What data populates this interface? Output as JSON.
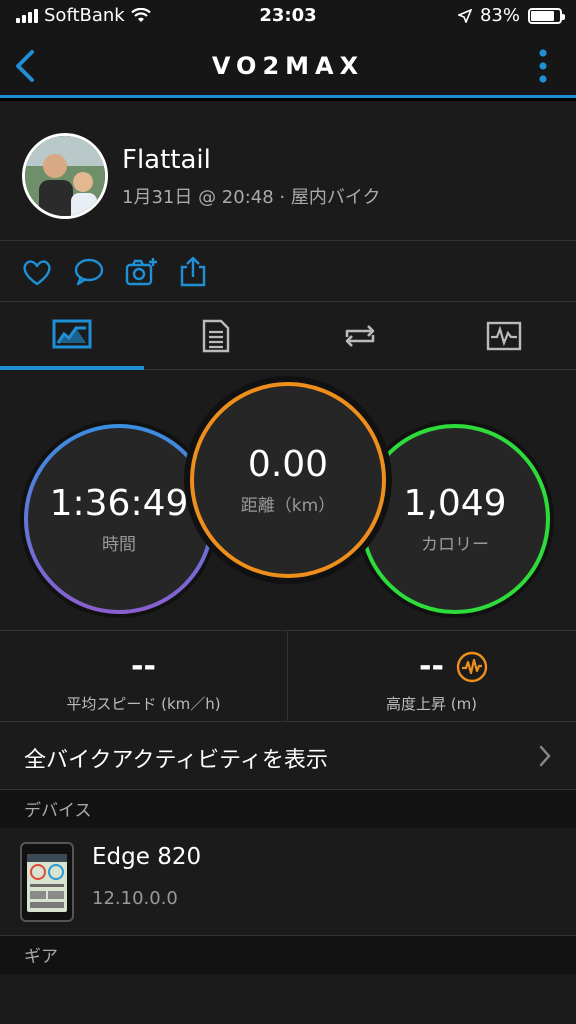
{
  "status_bar": {
    "carrier": "SoftBank",
    "time": "23:03",
    "battery": "83%",
    "battery_level": 0.83
  },
  "nav": {
    "title": "VO2MAX"
  },
  "activity": {
    "user_name": "Flattail",
    "meta": "1月31日 @ 20:48 · 屋内バイク"
  },
  "circles": {
    "time": {
      "value": "1:36:49",
      "label": "時間"
    },
    "distance": {
      "value": "0.00",
      "label": "距離（km）"
    },
    "calories": {
      "value": "1,049",
      "label": "カロリー"
    }
  },
  "stats": {
    "avg_speed": {
      "value": "--",
      "label": "平均スピード (km／h)"
    },
    "elevation": {
      "value": "--",
      "label": "高度上昇 (m)"
    }
  },
  "links": {
    "all_bike_activities": "全バイクアクティビティを表示"
  },
  "sections": {
    "device": "デバイス",
    "gear": "ギア"
  },
  "device": {
    "name": "Edge 820",
    "version": "12.10.0.0"
  },
  "colors": {
    "accent": "#1f8fd6",
    "time_ring_start": "#3a8ee0",
    "time_ring_end": "#8a5fd0",
    "distance_ring": "#ef8f1b",
    "calories_ring": "#2ddc3a"
  }
}
